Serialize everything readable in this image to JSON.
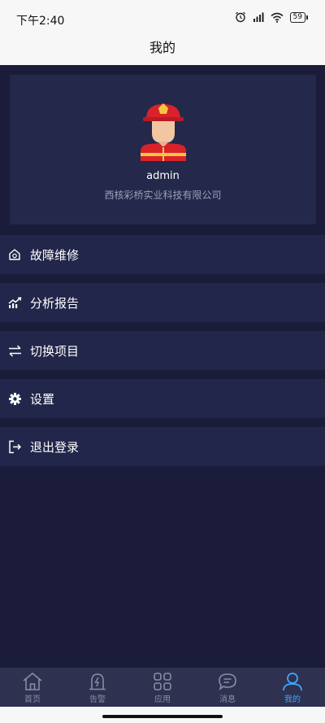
{
  "status_bar": {
    "time": "下午2:40",
    "battery": "59"
  },
  "header": {
    "title": "我的"
  },
  "profile": {
    "username": "admin",
    "company": "西核彩桥实业科技有限公司"
  },
  "menu": [
    {
      "label": "故障维修",
      "icon": "repair-house-icon"
    },
    {
      "label": "分析报告",
      "icon": "trend-chart-icon"
    },
    {
      "label": "切换项目",
      "icon": "swap-arrows-icon"
    },
    {
      "label": "设置",
      "icon": "gear-icon"
    },
    {
      "label": "退出登录",
      "icon": "logout-icon"
    }
  ],
  "tabs": [
    {
      "label": "首页",
      "icon": "home-icon",
      "active": false
    },
    {
      "label": "告警",
      "icon": "alarm-icon",
      "active": false
    },
    {
      "label": "应用",
      "icon": "apps-grid-icon",
      "active": false
    },
    {
      "label": "消息",
      "icon": "message-icon",
      "active": false
    },
    {
      "label": "我的",
      "icon": "user-icon",
      "active": true
    }
  ],
  "colors": {
    "background": "#1b1c3a",
    "card": "#24284a",
    "menu": "#22264a",
    "tab_active": "#3fa6ff",
    "tab_inactive": "#8a8da3"
  }
}
